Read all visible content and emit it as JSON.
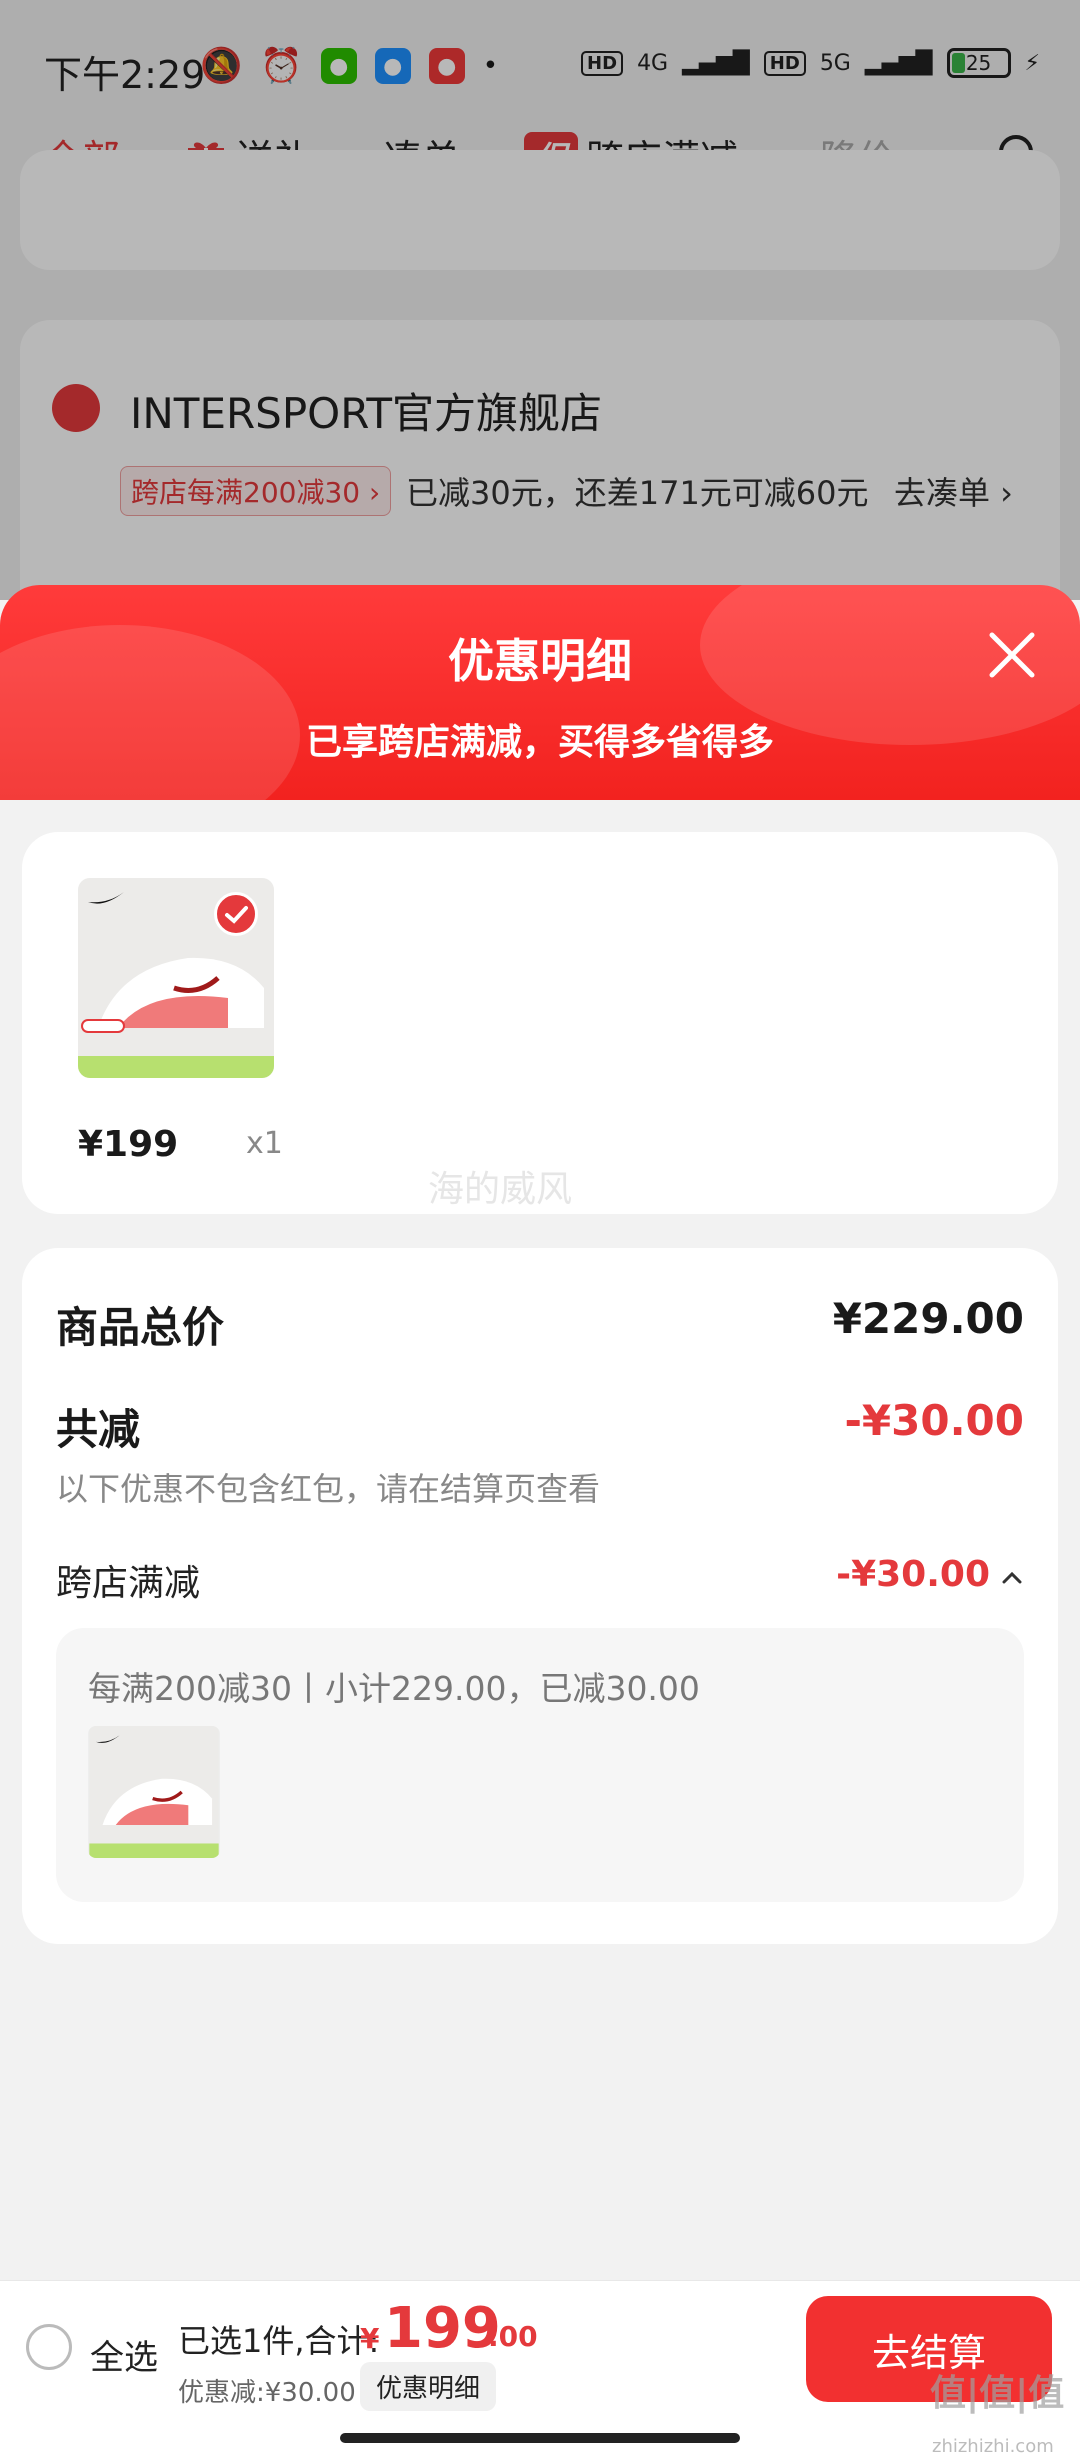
{
  "status_bar": {
    "time": "下午2:29",
    "network_1": "4G",
    "network_2": "5G",
    "hd_1": "HD",
    "hd_2": "HD",
    "battery": "25"
  },
  "tabs": [
    {
      "label": "全部"
    },
    {
      "label": "送礼"
    },
    {
      "label": "凑单"
    },
    {
      "label": "跨店满减",
      "badge": "促"
    },
    {
      "label": "降价"
    }
  ],
  "background": {
    "shop_name": "INTERSPORT官方旗舰店",
    "shop_tag": "跨店每满200减30 ›",
    "shop_msg": "已减30元，还差171元可减60元",
    "shop_action": "去凑单 ›"
  },
  "sheet": {
    "title": "优惠明细",
    "subtitle": "已享跨店满减，买得多省得多",
    "product": {
      "price": "¥199",
      "qty": "x1",
      "watermark": "海的威风"
    },
    "summary": {
      "total_label": "商品总价",
      "total_value": "¥229.00",
      "discount_label": "共减",
      "discount_value": "-¥30.00",
      "note": "以下优惠不包含红包，请在结算页查看",
      "promo_label": "跨店满减",
      "promo_value": "-¥30.00",
      "promo_detail": "每满200减30丨小计229.00，已减30.00"
    }
  },
  "bottom_bar": {
    "select_all": "全选",
    "selected_prefix": "已选1件,合计:",
    "yen": "¥",
    "total_int": "199",
    "total_dec": ".00",
    "discount_line": "优惠减:¥30.00",
    "detail_chip": "优惠明细",
    "checkout": "去结算",
    "corner_watermark": "值|值|值",
    "corner_watermark_url": "zhizhizhi.com"
  },
  "colors": {
    "accent": "#e4393c",
    "checkout": "#f23030"
  }
}
